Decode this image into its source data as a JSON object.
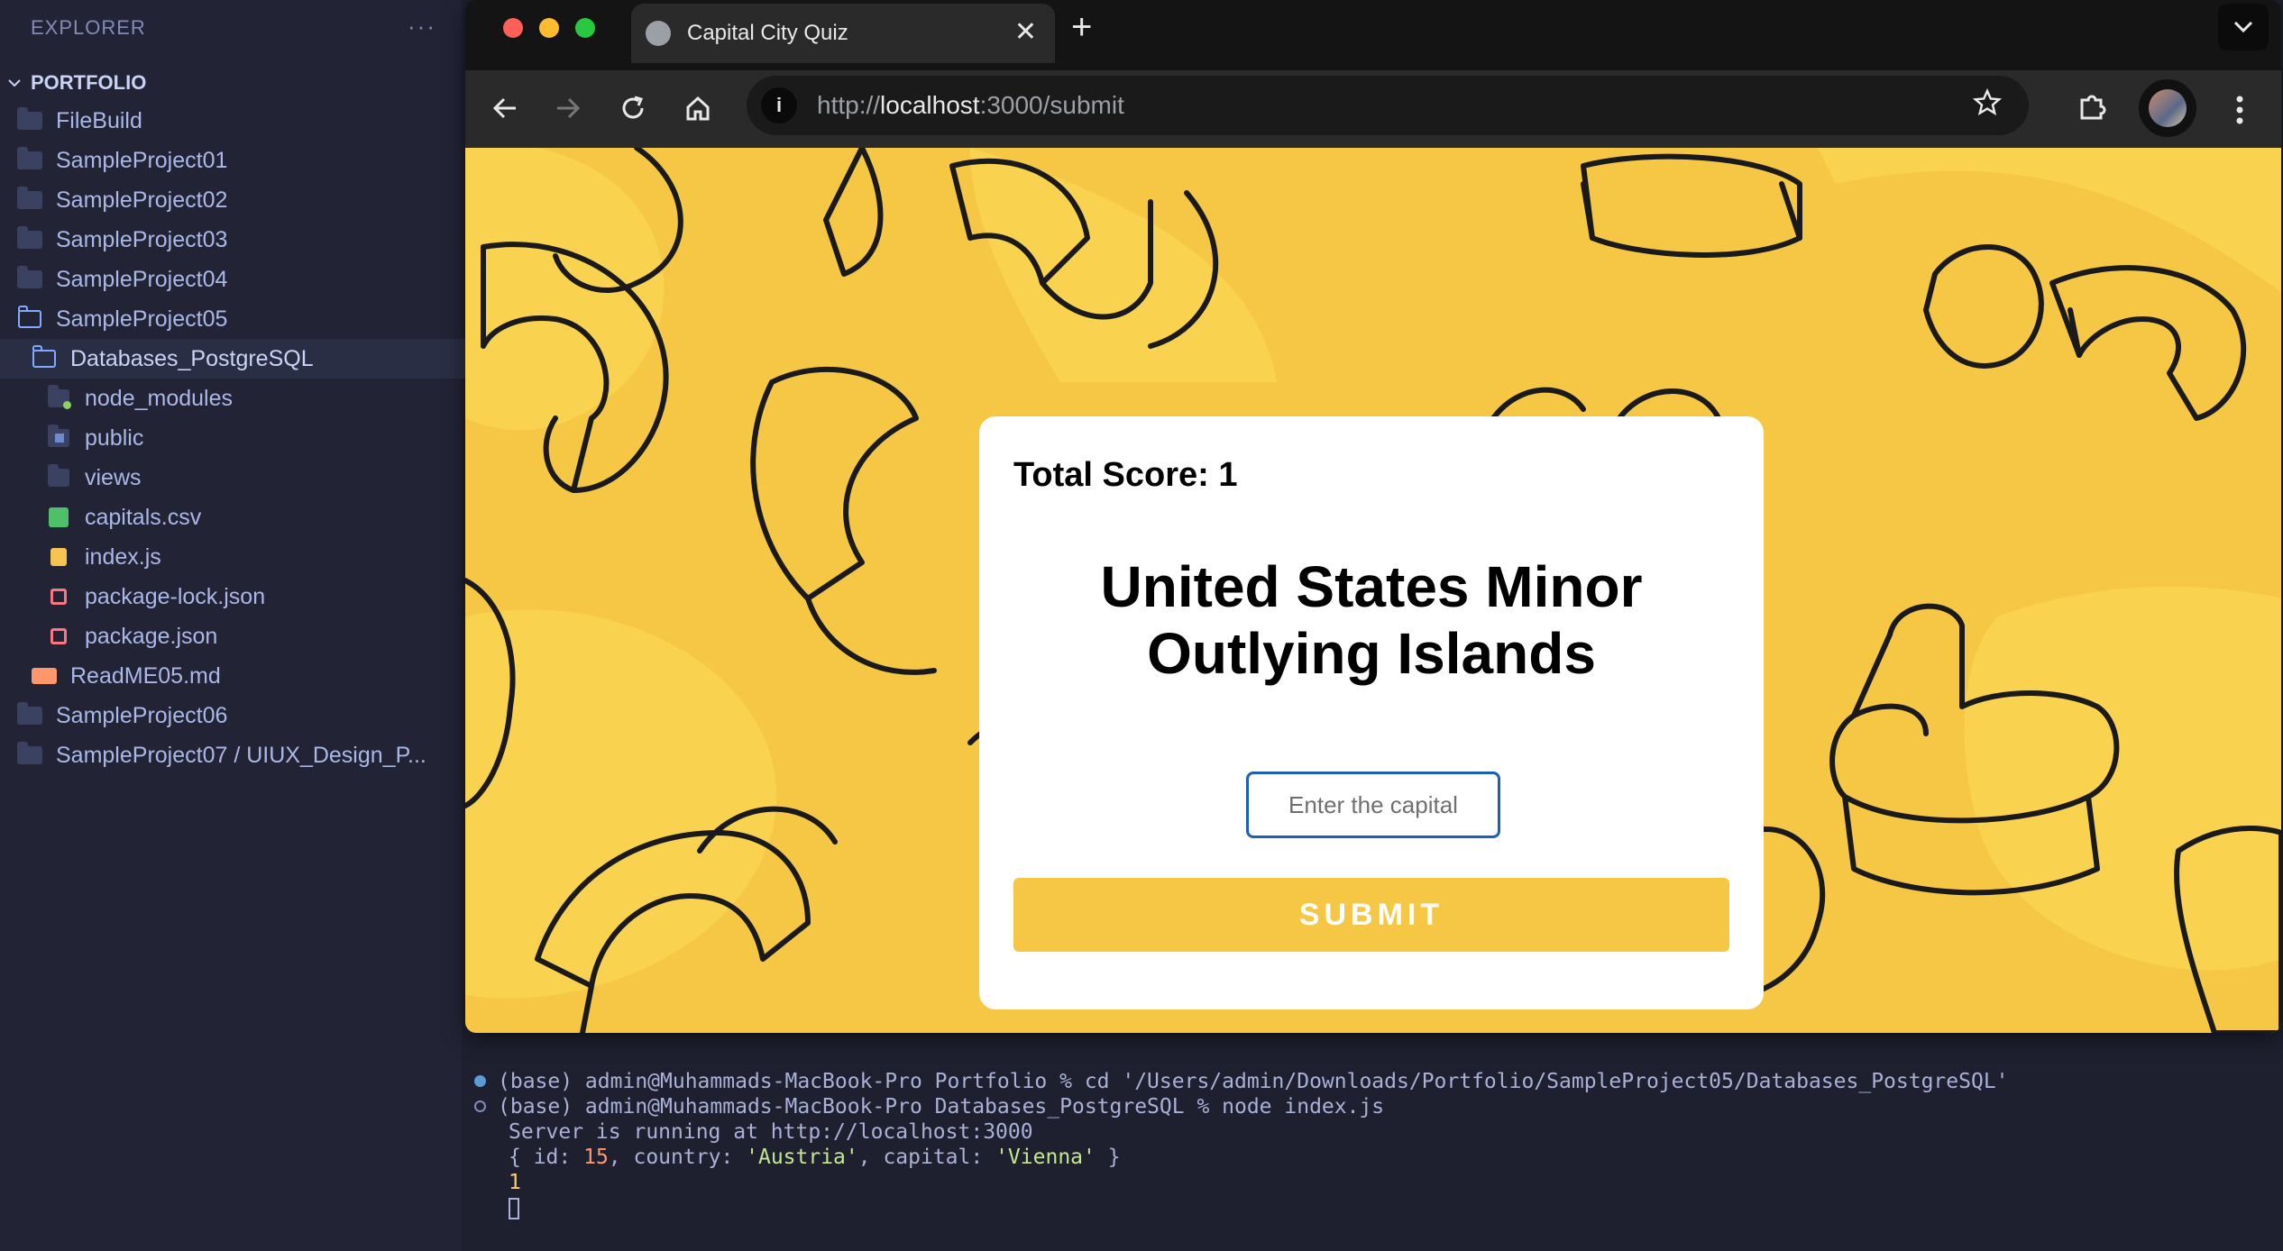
{
  "explorer": {
    "header": "EXPLORER",
    "more": "···",
    "root": "PORTFOLIO",
    "items": [
      {
        "label": "FileBuild"
      },
      {
        "label": "SampleProject01"
      },
      {
        "label": "SampleProject02"
      },
      {
        "label": "SampleProject03"
      },
      {
        "label": "SampleProject04"
      },
      {
        "label": "SampleProject05"
      },
      {
        "label": "Databases_PostgreSQL"
      },
      {
        "label": "node_modules"
      },
      {
        "label": "public"
      },
      {
        "label": "views"
      },
      {
        "label": "capitals.csv"
      },
      {
        "label": "index.js"
      },
      {
        "label": "package-lock.json"
      },
      {
        "label": "package.json"
      },
      {
        "label": "ReadME05.md"
      },
      {
        "label": "SampleProject06"
      },
      {
        "label": "SampleProject07 / UIUX_Design_P..."
      }
    ]
  },
  "browser": {
    "tab_title": "Capital City Quiz",
    "tab_close": "✕",
    "new_tab": "+",
    "url_prefix": "http://",
    "url_host": "localhost",
    "url_rest": ":3000/submit"
  },
  "quiz": {
    "score_label": "Total Score: 1",
    "country": "United States Minor Outlying Islands",
    "input_placeholder": "Enter the capital",
    "submit_label": "SUBMIT"
  },
  "terminal": {
    "line1": "(base) admin@Muhammads-MacBook-Pro Portfolio % cd '/Users/admin/Downloads/Portfolio/SampleProject05/Databases_PostgreSQL'",
    "line2": "(base) admin@Muhammads-MacBook-Pro Databases_PostgreSQL % node index.js",
    "line3": "Server is running at http://localhost:3000",
    "line4_a": "{ id: ",
    "line4_id": "15",
    "line4_b": ", country: ",
    "line4_country": "'Austria'",
    "line4_c": ", capital: ",
    "line4_capital": "'Vienna'",
    "line4_d": " }",
    "line5": "1"
  },
  "colors": {
    "page_bg": "#f6c745",
    "button": "#f6c745",
    "input_border": "#1b5fb6",
    "sidebar_bg": "#222436",
    "terminal_bg": "#1e2030"
  }
}
